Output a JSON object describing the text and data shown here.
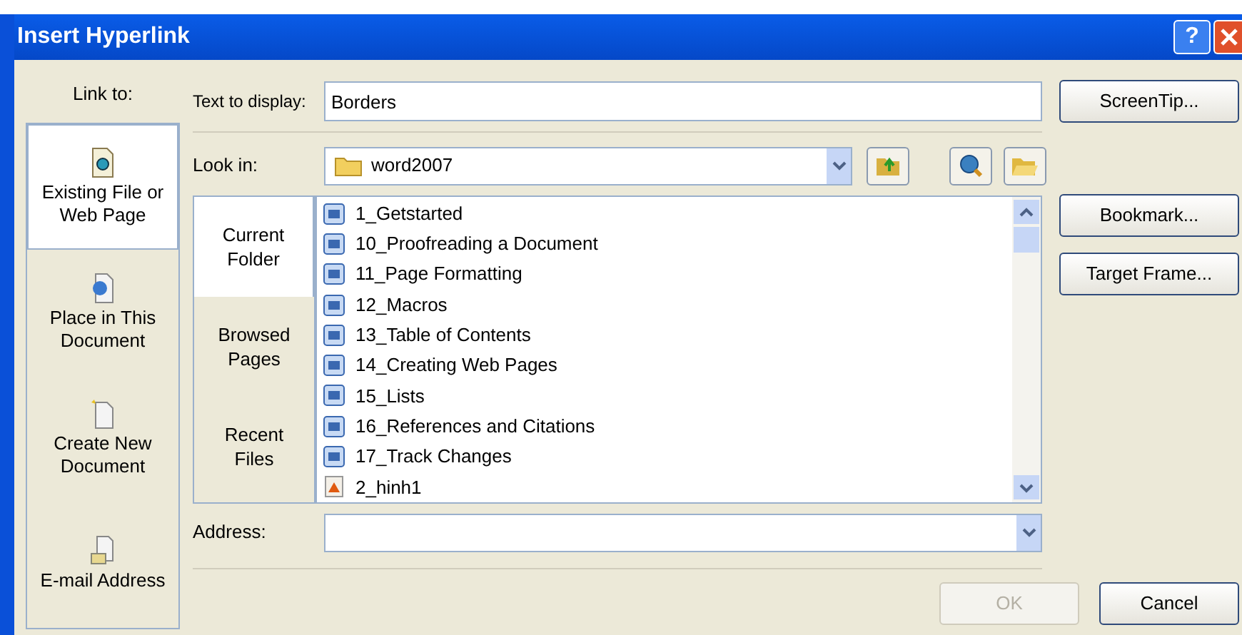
{
  "window": {
    "title": "Insert Hyperlink",
    "help": "?"
  },
  "link_to": {
    "label": "Link to:",
    "items": [
      {
        "label": "Existing File or Web Page",
        "selected": true,
        "kind": "file"
      },
      {
        "label": "Place in This Document",
        "selected": false,
        "kind": "place"
      },
      {
        "label": "Create New Document",
        "selected": false,
        "kind": "new"
      },
      {
        "label": "E-mail Address",
        "selected": false,
        "kind": "email"
      }
    ]
  },
  "text_to_display": {
    "label": "Text to display:",
    "value": "Borders"
  },
  "screentip_button": "ScreenTip...",
  "look_in": {
    "label": "Look in:",
    "value": "word2007"
  },
  "places": [
    {
      "label": "Current Folder",
      "selected": true
    },
    {
      "label": "Browsed Pages",
      "selected": false
    },
    {
      "label": "Recent Files",
      "selected": false
    }
  ],
  "files": [
    {
      "name": "1_Getstarted",
      "kind": "doc"
    },
    {
      "name": "10_Proofreading a Document",
      "kind": "doc"
    },
    {
      "name": "11_Page Formatting",
      "kind": "doc"
    },
    {
      "name": "12_Macros",
      "kind": "doc"
    },
    {
      "name": "13_Table of Contents",
      "kind": "doc"
    },
    {
      "name": "14_Creating Web Pages",
      "kind": "doc"
    },
    {
      "name": "15_Lists",
      "kind": "doc"
    },
    {
      "name": "16_References and Citations",
      "kind": "doc"
    },
    {
      "name": "17_Track Changes",
      "kind": "doc"
    },
    {
      "name": "2_hinh1",
      "kind": "image"
    }
  ],
  "side_buttons": [
    "Bookmark...",
    "Target Frame..."
  ],
  "address": {
    "label": "Address:"
  },
  "footer_buttons": [
    {
      "label": "OK",
      "disabled": true
    },
    {
      "label": "Cancel",
      "disabled": false
    }
  ]
}
